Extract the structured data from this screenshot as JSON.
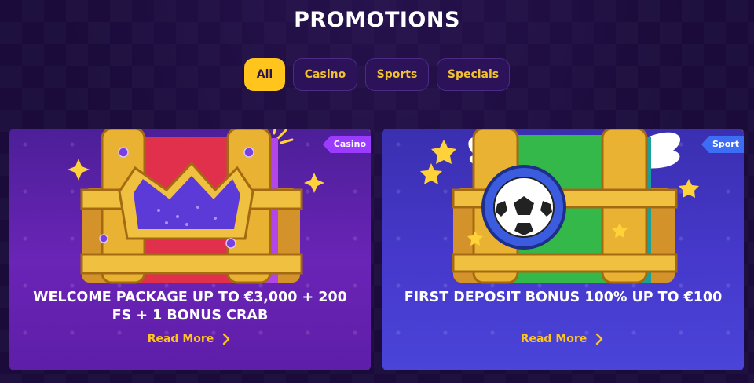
{
  "header": {
    "title": "PROMOTIONS"
  },
  "filters": [
    {
      "label": "All",
      "active": true
    },
    {
      "label": "Casino",
      "active": false
    },
    {
      "label": "Sports",
      "active": false
    },
    {
      "label": "Specials",
      "active": false
    }
  ],
  "cards": [
    {
      "tag": "Casino",
      "title": "WELCOME PACKAGE UP TO €3,000 + 200 FS + 1 BONUS CRAB",
      "link_label": "Read More",
      "art": "treasure-chest-crown"
    },
    {
      "tag": "Sport",
      "title": "FIRST DEPOSIT BONUS 100% UP TO €100",
      "link_label": "Read More",
      "art": "treasure-chest-soccer-ball"
    }
  ],
  "colors": {
    "accent": "#ffc51c",
    "casino_card": "#6a24b6",
    "sport_card": "#4639cc"
  }
}
